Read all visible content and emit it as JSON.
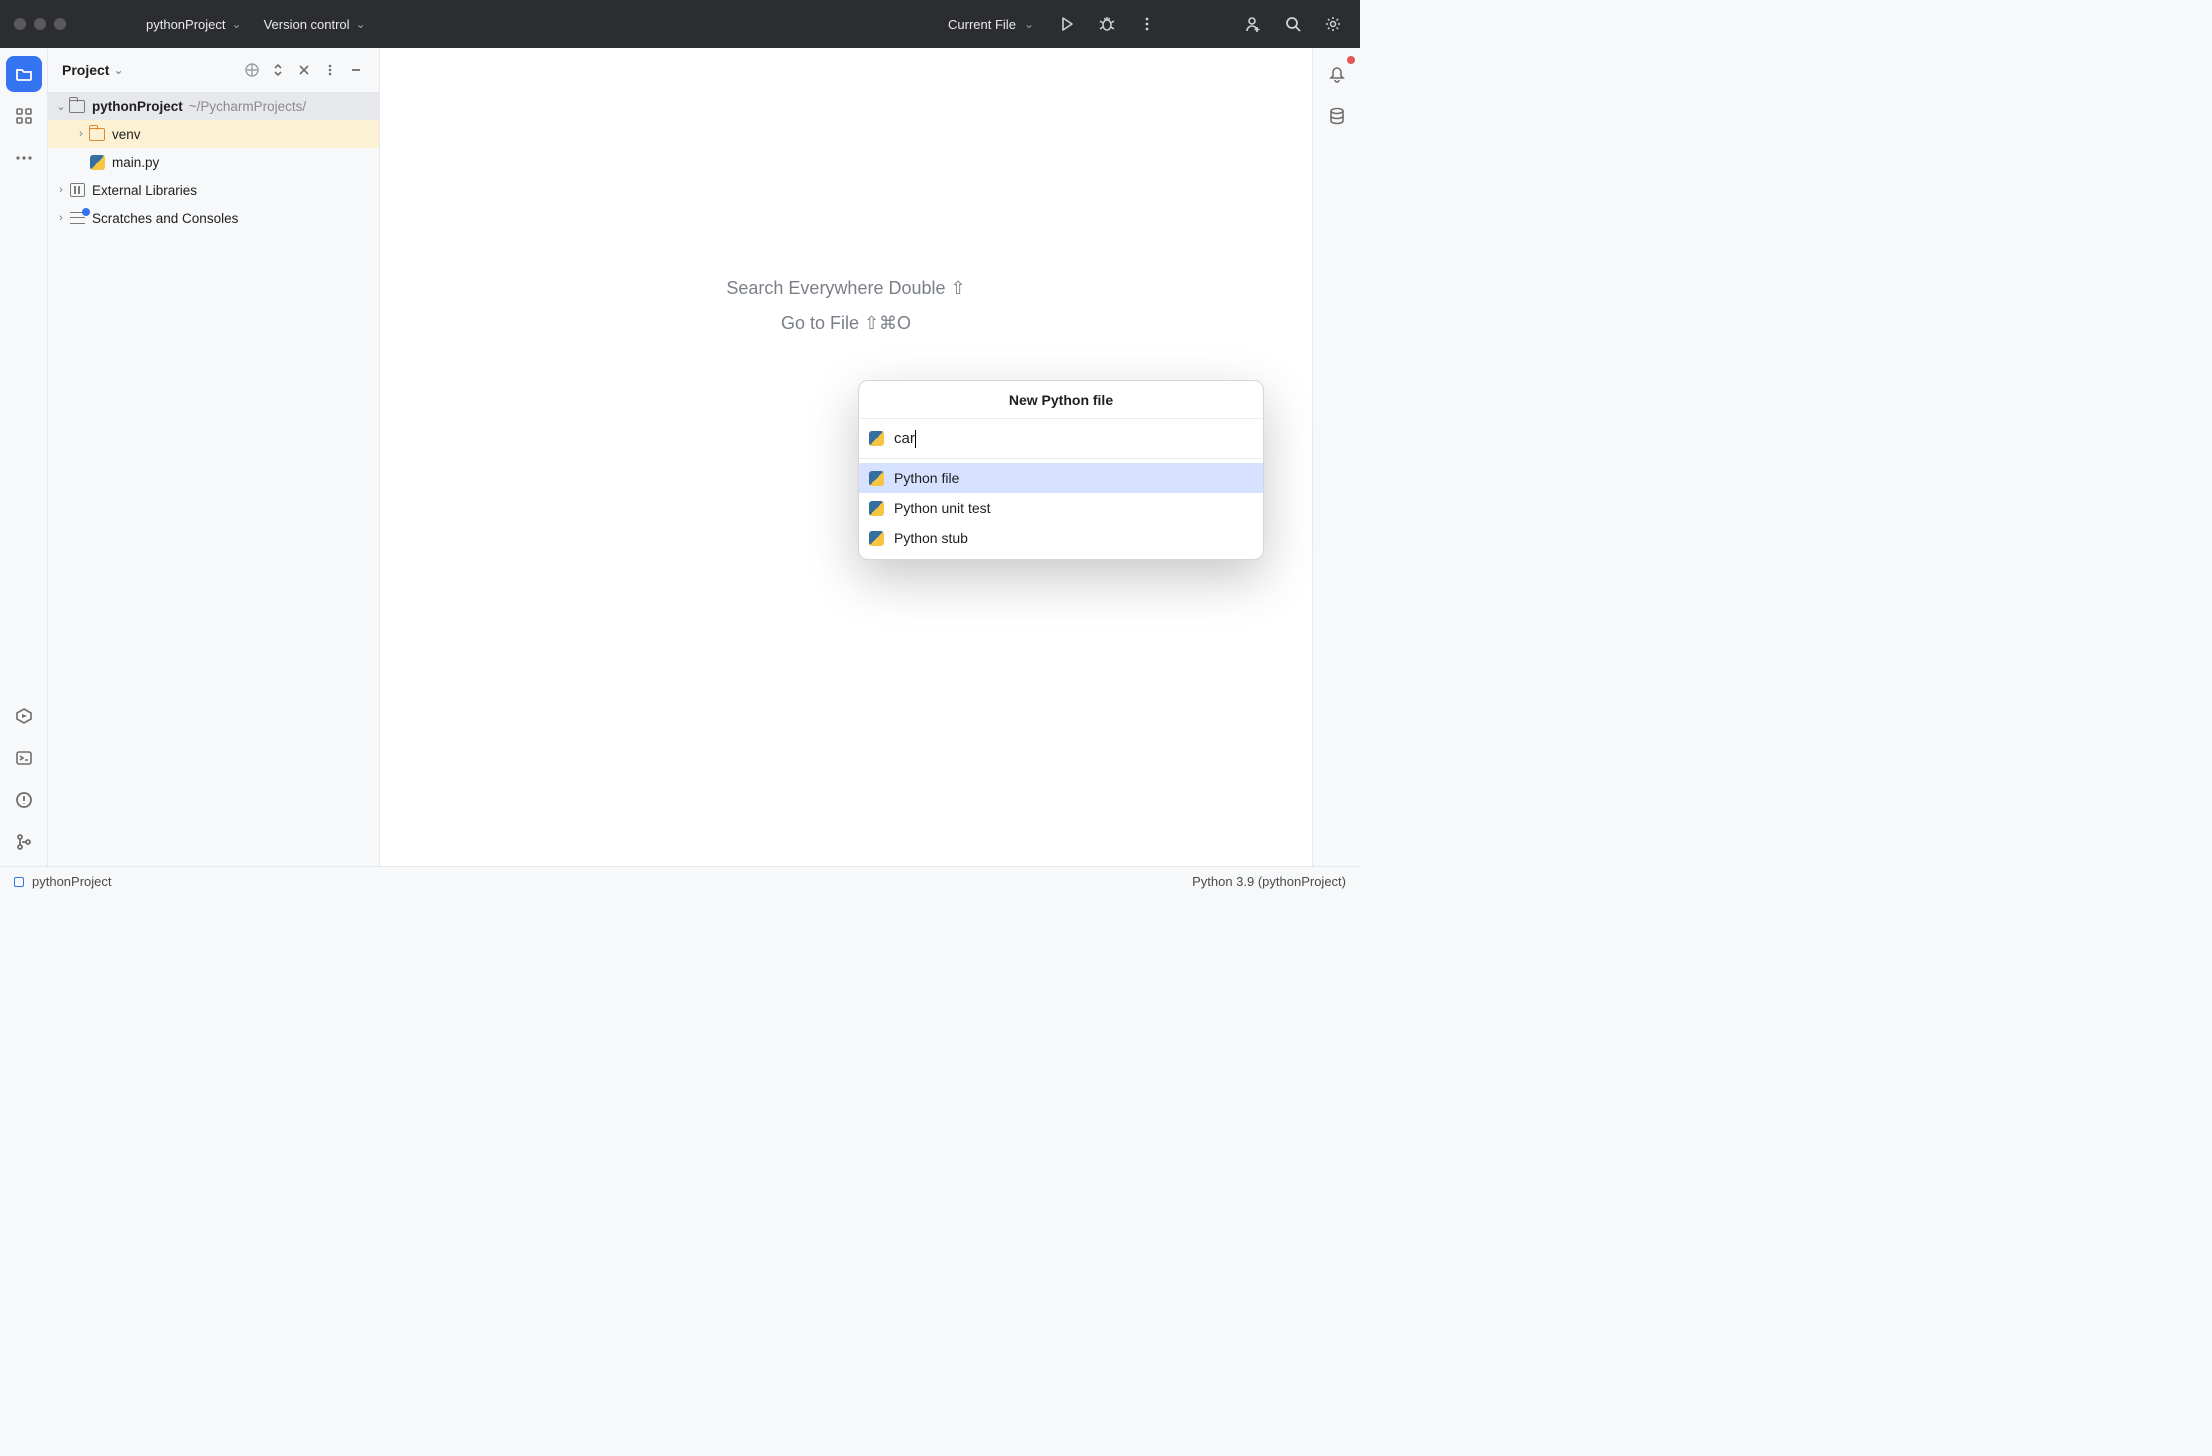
{
  "titlebar": {
    "project_name": "pythonProject",
    "vcs_label": "Version control",
    "run_config": "Current File"
  },
  "tree_panel": {
    "title": "Project"
  },
  "tree": {
    "root": {
      "name": "pythonProject",
      "path": "~/PycharmProjects/"
    },
    "venv": "venv",
    "mainpy": "main.py",
    "ext_libs": "External Libraries",
    "scratches": "Scratches and Consoles"
  },
  "hints": {
    "search": "Search Everywhere Double ⇧",
    "goto": "Go to File ⇧⌘O"
  },
  "popup": {
    "title": "New Python file",
    "input_value": "car",
    "options": [
      "Python file",
      "Python unit test",
      "Python stub"
    ]
  },
  "statusbar": {
    "project": "pythonProject",
    "interpreter": "Python 3.9 (pythonProject)"
  }
}
